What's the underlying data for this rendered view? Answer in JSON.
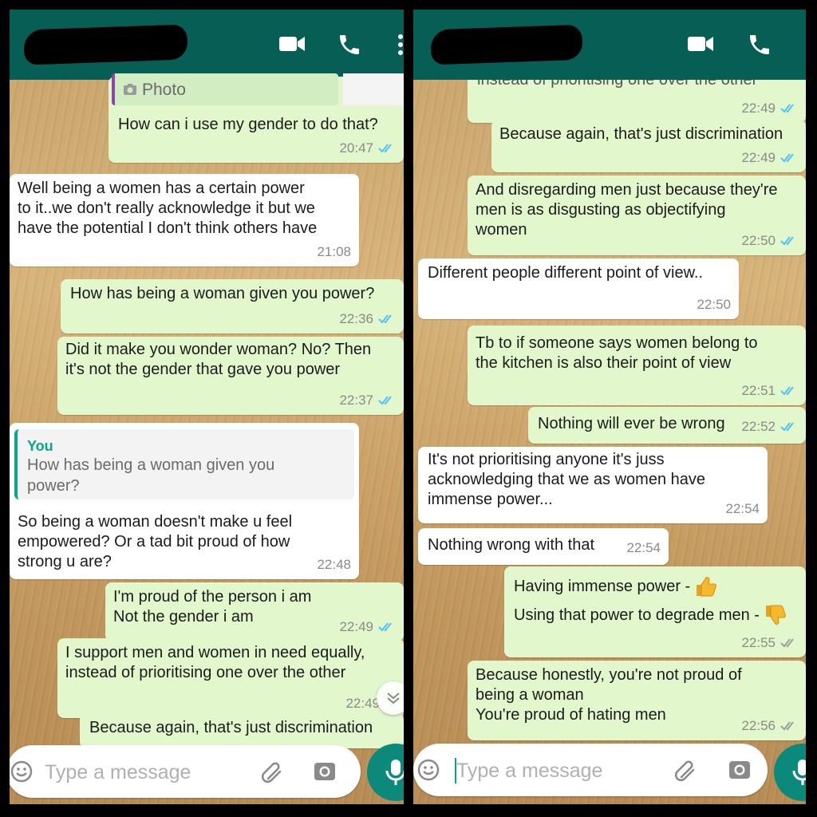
{
  "left": {
    "photo_label": "Photo",
    "messages": [
      {
        "text": "How can i use my gender to do that?",
        "time": "20:47"
      },
      {
        "text": "Well being a women has a certain power\nto  it..we don't really acknowledge it but we\nhave the potential I don't think others have",
        "time": "21:08"
      },
      {
        "text": "How has being a woman given you power?",
        "time": "22:36"
      },
      {
        "text": "Did it make you wonder woman? No? Then\nit's not the gender that gave you power",
        "time": "22:37"
      },
      {
        "quote_author": "You",
        "quote_text": "How has being a woman given you\npower?",
        "text": "So being a woman doesn't make u feel\nempowered? Or a tad bit proud of how\nstrong u are?",
        "time": "22:48"
      },
      {
        "text": "I'm proud of the person i am\nNot the gender i am",
        "time": "22:49"
      },
      {
        "text": "I support men and women in need equally,\ninstead of prioritising one over the other",
        "time": "22:49"
      },
      {
        "text": "Because again, that's just discrimination"
      }
    ],
    "placeholder": "Type a message"
  },
  "right": {
    "messages": [
      {
        "text": "instead of prioritising one over the other",
        "time": "22:49"
      },
      {
        "text": "Because again, that's just discrimination",
        "time": "22:49"
      },
      {
        "text": "And disregarding men just because they're\nmen is as disgusting as objectifying\nwomen",
        "time": "22:50"
      },
      {
        "text": "Different people different point of view..",
        "time": "22:50"
      },
      {
        "text": "Tb to if someone says women belong to\nthe kitchen is also their point of view",
        "time": "22:51"
      },
      {
        "text": "Nothing will ever be wrong",
        "time": "22:52"
      },
      {
        "text": "It's not prioritising anyone it's juss\nacknowledging that we as women have\nimmense power...",
        "time": "22:54"
      },
      {
        "text": "Nothing wrong with that",
        "time": "22:54"
      },
      {
        "line1": "Having immense power -",
        "line2": "Using that power to degrade men -",
        "time": "22:55"
      },
      {
        "text": "Because honestly, you're not proud of\nbeing a woman\nYou're proud of hating men",
        "time": "22:56"
      }
    ],
    "placeholder": "Type a message"
  },
  "icons": {
    "video_call": "video-camera-icon",
    "voice_call": "phone-icon",
    "menu": "more-vertical-icon",
    "read_receipt": "double-check-icon",
    "emoji": "smiley-icon",
    "attach": "paperclip-icon",
    "camera": "camera-icon",
    "mic": "microphone-icon",
    "scroll": "chevrons-down-icon",
    "thumbs_up": "thumbs-up-emoji",
    "thumbs_down": "thumbs-down-emoji"
  },
  "colors": {
    "header": "#075e54",
    "outgoing_bubble": "#e2f7cb",
    "incoming_bubble": "#ffffff",
    "read_ticks": "#4fc3f7",
    "quote_accent": "#07a884",
    "mic_button": "#0b8a7c"
  }
}
